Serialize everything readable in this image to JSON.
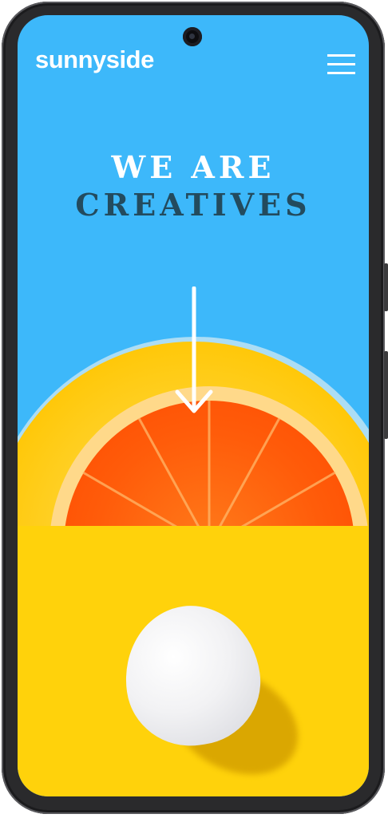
{
  "header": {
    "logo": "sunnyside",
    "menu_icon": "hamburger-menu-icon"
  },
  "hero": {
    "title_line1": "WE ARE",
    "title_line2": "CREATIVES",
    "scroll_icon": "arrow-down-icon",
    "image": "orange-half-in-glass"
  },
  "section": {
    "image": "white-egg-on-yellow"
  },
  "colors": {
    "sky": "#3db8fa",
    "title_dark": "#234b5e",
    "yellow": "#ffd20b",
    "orange": "#ff5c0a"
  }
}
